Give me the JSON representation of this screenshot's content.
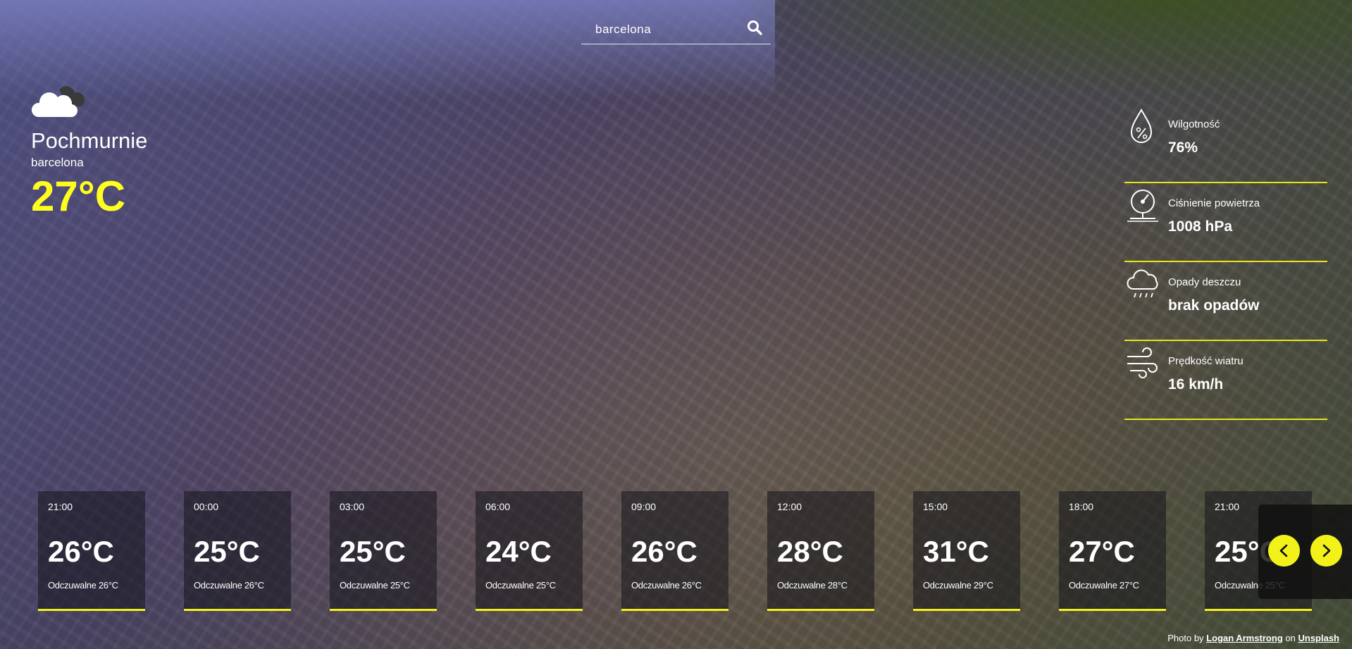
{
  "search": {
    "value": "barcelona"
  },
  "current": {
    "condition": "Pochmurnie",
    "city": "barcelona",
    "temperature": "27°C",
    "icon": "cloud-icon"
  },
  "details": [
    {
      "label": "Wilgotność",
      "value": "76%",
      "icon": "humidity-drop-icon"
    },
    {
      "label": "Ciśnienie powietrza",
      "value": "1008 hPa",
      "icon": "barometer-icon"
    },
    {
      "label": "Opady deszczu",
      "value": "brak opadów",
      "icon": "rain-cloud-icon"
    },
    {
      "label": "Prędkość wiatru",
      "value": "16 km/h",
      "icon": "wind-icon"
    }
  ],
  "forecast": [
    {
      "hour": "21:00",
      "temp": "26°C",
      "feels": "Odczuwalne 26°C"
    },
    {
      "hour": "00:00",
      "temp": "25°C",
      "feels": "Odczuwalne 26°C"
    },
    {
      "hour": "03:00",
      "temp": "25°C",
      "feels": "Odczuwalne 25°C"
    },
    {
      "hour": "06:00",
      "temp": "24°C",
      "feels": "Odczuwalne 25°C"
    },
    {
      "hour": "09:00",
      "temp": "26°C",
      "feels": "Odczuwalne 26°C"
    },
    {
      "hour": "12:00",
      "temp": "28°C",
      "feels": "Odczuwalne 28°C"
    },
    {
      "hour": "15:00",
      "temp": "31°C",
      "feels": "Odczuwalne 29°C"
    },
    {
      "hour": "18:00",
      "temp": "27°C",
      "feels": "Odczuwalne 27°C"
    },
    {
      "hour": "21:00",
      "temp": "25°C",
      "feels": "Odczuwalne 25°C"
    }
  ],
  "nav": {
    "prev_icon": "chevron-left-icon",
    "next_icon": "chevron-right-icon"
  },
  "credit": {
    "prefix": "Photo by",
    "author": "Logan Armstrong",
    "on": "on",
    "site": "Unsplash"
  },
  "colors": {
    "accent": "#f2f21a",
    "temp": "#ffff1f"
  }
}
